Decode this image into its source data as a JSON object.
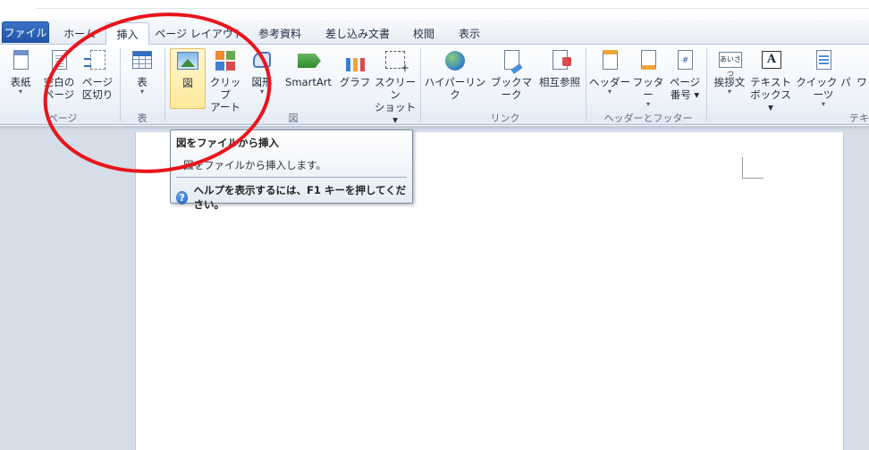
{
  "tabs": [
    {
      "label": "ファイル"
    },
    {
      "label": "ホーム"
    },
    {
      "label": "挿入"
    },
    {
      "label": "ページ レイアウト"
    },
    {
      "label": "参考資料"
    },
    {
      "label": "差し込み文書"
    },
    {
      "label": "校閲"
    },
    {
      "label": "表示"
    }
  ],
  "ribbon": {
    "pages": {
      "label": "ページ",
      "cover": {
        "l1": "表紙",
        "dd": "▾"
      },
      "blank": {
        "l1": "空白の",
        "l2": "ページ"
      },
      "break": {
        "l1": "ページ",
        "l2": "区切り"
      }
    },
    "table": {
      "label": "表",
      "btn": {
        "l1": "表",
        "dd": "▾"
      }
    },
    "illustrations": {
      "label": "図",
      "picture": {
        "l1": "図"
      },
      "clipart": {
        "l1": "クリップ",
        "l2": "アート"
      },
      "shapes": {
        "l1": "図形",
        "dd": "▾"
      },
      "smartart": {
        "l1": "SmartArt"
      },
      "chart": {
        "l1": "グラフ"
      },
      "screenshot": {
        "l1": "スクリーン",
        "l2": "ショット ▾"
      }
    },
    "links": {
      "label": "リンク",
      "hyperlink": {
        "l1": "ハイパーリンク"
      },
      "bookmark": {
        "l1": "ブックマーク"
      },
      "crossref": {
        "l1": "相互参照"
      }
    },
    "header_footer": {
      "label": "ヘッダーとフッター",
      "header": {
        "l1": "ヘッダー",
        "dd": "▾"
      },
      "footer": {
        "l1": "フッター",
        "dd": "▾"
      },
      "pagenum": {
        "l1": "ページ",
        "l2": "番号 ▾",
        "icon_text": "#"
      }
    },
    "text": {
      "label": "テキ",
      "greeting": {
        "l1": "挨拶文",
        "dd": "▾",
        "icon_text": "あいさつ"
      },
      "textbox": {
        "l1": "テキスト",
        "l2": "ボックス ▾",
        "icon_text": "A"
      },
      "quickparts": {
        "l1": "クイック パーツ",
        "dd": "▾"
      },
      "wordart": {
        "l1": "ワ"
      }
    }
  },
  "tooltip": {
    "title": "図をファイルから挿入",
    "description": "図をファイルから挿入します。",
    "help_icon": "?",
    "help_text": "ヘルプを表示するには、F1 キーを押してください。"
  },
  "colors": {
    "annotation_circle": "#e8141b",
    "file_tab": "#2a62b8"
  }
}
